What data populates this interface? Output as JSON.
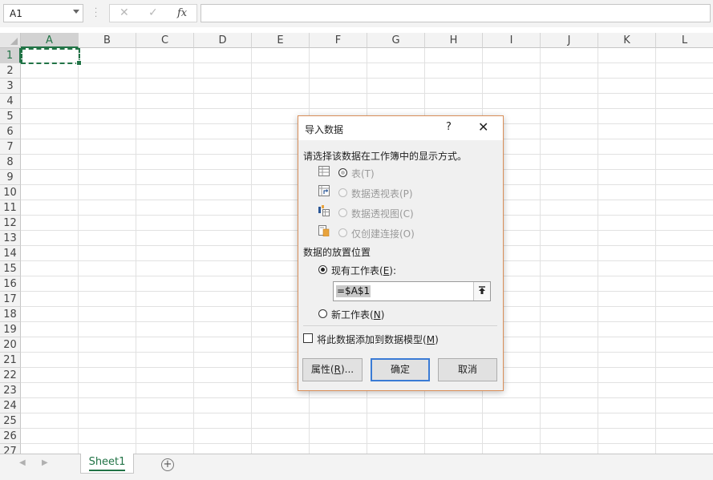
{
  "formula_bar": {
    "name_box": "A1",
    "cancel_glyph": "✕",
    "enter_glyph": "✓",
    "fx_label": "fx",
    "formula": ""
  },
  "grid": {
    "columns": [
      "A",
      "B",
      "C",
      "D",
      "E",
      "F",
      "G",
      "H",
      "I",
      "J",
      "K",
      "L"
    ],
    "rows": [
      "1",
      "2",
      "3",
      "4",
      "5",
      "6",
      "7",
      "8",
      "9",
      "10",
      "11",
      "12",
      "13",
      "14",
      "15",
      "16",
      "17",
      "18",
      "19",
      "20",
      "21",
      "22",
      "23",
      "24",
      "25",
      "26",
      "27"
    ],
    "active_cell": "A1"
  },
  "sheet_tabs": {
    "tabs": [
      "Sheet1"
    ],
    "add_glyph": "+"
  },
  "dialog": {
    "title": "导入数据",
    "help": "?",
    "close": "✕",
    "prompt": "请选择该数据在工作簿中的显示方式。",
    "display_options": [
      {
        "label": "表(T)",
        "icon": "table-icon"
      },
      {
        "label": "数据透视表(P)",
        "icon": "pivot-table-icon"
      },
      {
        "label": "数据透视图(C)",
        "icon": "pivot-chart-icon"
      },
      {
        "label": "仅创建连接(O)",
        "icon": "connection-only-icon"
      }
    ],
    "placement_heading": "数据的放置位置",
    "existing_sheet": {
      "label": "现有工作表",
      "key": "E",
      "suffix": "):",
      "prefix": "("
    },
    "range_value": "=$A$1",
    "new_sheet": {
      "label": "新工作表",
      "key": "N",
      "prefix": "(",
      "suffix": ")"
    },
    "add_to_model": {
      "label": "将此数据添加到数据模型",
      "key": "M",
      "prefix": "(",
      "suffix": ")"
    },
    "buttons": {
      "properties": {
        "label": "属性",
        "key": "R",
        "suffix": ")...",
        "prefix": "("
      },
      "ok": "确定",
      "cancel": "取消"
    },
    "colors": {
      "border": "#d98e58",
      "accent": "#217346",
      "primary_focus": "#3a7bd5"
    }
  }
}
